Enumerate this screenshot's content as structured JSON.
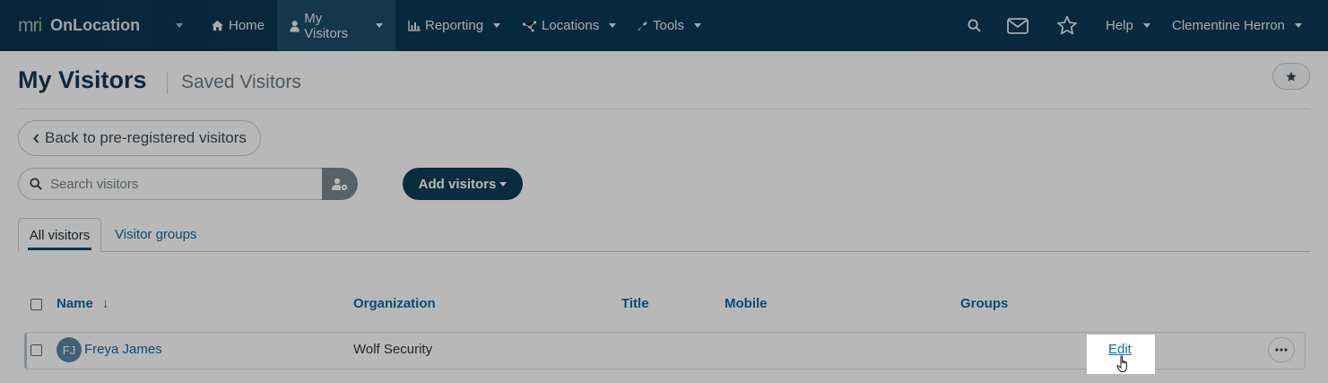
{
  "app": {
    "logo_text": "mri",
    "brand_name": "OnLocation"
  },
  "nav": {
    "items": [
      {
        "label": "Home",
        "icon": "home-icon"
      },
      {
        "label": "My Visitors",
        "icon": "person-icon",
        "active": true
      },
      {
        "label": "Reporting",
        "icon": "bar-chart-icon"
      },
      {
        "label": "Locations",
        "icon": "network-icon"
      },
      {
        "label": "Tools",
        "icon": "wrench-icon"
      }
    ],
    "right_icons": [
      "search-icon",
      "envelope-icon",
      "star-icon"
    ],
    "help_label": "Help",
    "user_name": "Clementine Herron"
  },
  "page": {
    "title": "My Visitors",
    "subtitle": "Saved Visitors",
    "back_label": "Back to pre-registered visitors",
    "search_placeholder": "Search visitors",
    "add_label": "Add visitors"
  },
  "tabs": [
    {
      "label": "All visitors",
      "active": true
    },
    {
      "label": "Visitor groups",
      "active": false
    }
  ],
  "table": {
    "columns": [
      "Name",
      "Organization",
      "Title",
      "Mobile",
      "Groups"
    ],
    "sort_indicator": "↓",
    "rows": [
      {
        "initials": "FJ",
        "name": "Freya James",
        "organization": "Wolf Security",
        "title": "",
        "mobile": "",
        "groups": "",
        "edit_label": "Edit"
      }
    ]
  },
  "colors": {
    "navbar": "#0d3350",
    "navbar_active": "#1e4d6b",
    "primary_button": "#0f3e58",
    "link": "#1168a3",
    "title": "#123a54",
    "logo_accent": "#88c14b"
  }
}
